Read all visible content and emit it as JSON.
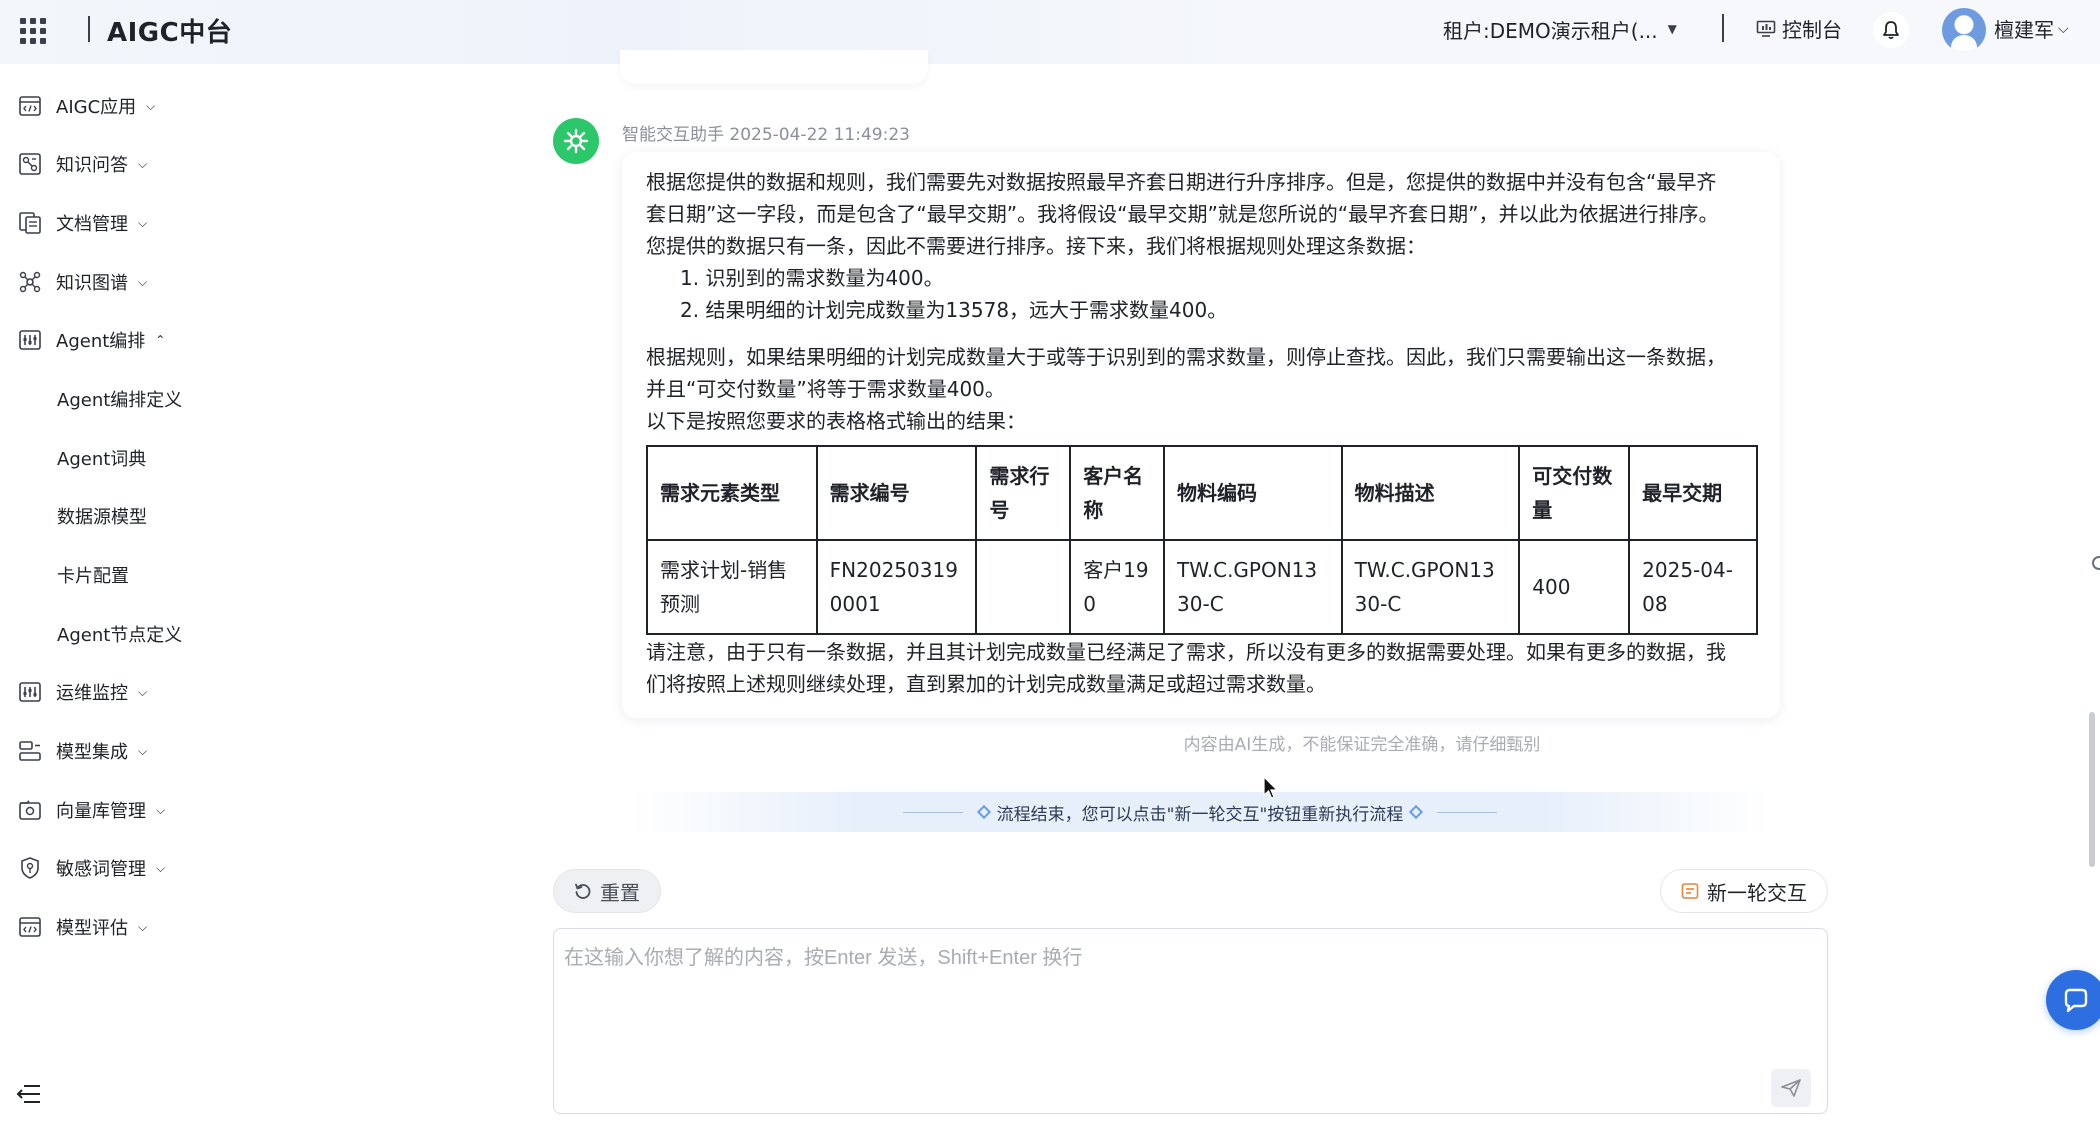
{
  "header": {
    "brand": "AIGC中台",
    "tenant": "租户:DEMO演示租户(...",
    "console": "控制台",
    "username": "檀建军"
  },
  "sidebar": {
    "items": [
      {
        "label": "AIGC应用",
        "icon": "code-window-icon",
        "expanded": false
      },
      {
        "label": "知识问答",
        "icon": "qa-icon",
        "expanded": false
      },
      {
        "label": "文档管理",
        "icon": "document-icon",
        "expanded": false
      },
      {
        "label": "知识图谱",
        "icon": "graph-icon",
        "expanded": false
      },
      {
        "label": "Agent编排",
        "icon": "sliders-icon",
        "expanded": true
      },
      {
        "label": "运维监控",
        "icon": "monitor-icon",
        "expanded": false
      },
      {
        "label": "模型集成",
        "icon": "model-icon",
        "expanded": false
      },
      {
        "label": "向量库管理",
        "icon": "vector-db-icon",
        "expanded": false
      },
      {
        "label": "敏感词管理",
        "icon": "shield-icon",
        "expanded": false
      },
      {
        "label": "模型评估",
        "icon": "evaluate-icon",
        "expanded": false
      }
    ],
    "subitems": [
      {
        "label": "Agent编排定义"
      },
      {
        "label": "Agent词典"
      },
      {
        "label": "数据源模型"
      },
      {
        "label": "卡片配置"
      },
      {
        "label": "Agent节点定义"
      }
    ]
  },
  "chat": {
    "sender": "智能交互助手",
    "timestamp": "2025-04-22 11:49:23",
    "paragraph1": [
      "根据您提供的数据和规则，我们需要先对数据按照最早齐套日期进行升序排序。但是，您提供的数据中并没有包含“最早齐",
      "套日期”这一字段，而是包含了“最早交期”。我将假设“最早交期”就是您所说的“最早齐套日期”，并以此为依据进行排序。",
      "您提供的数据只有一条，因此不需要进行排序。接下来，我们将根据规则处理这条数据："
    ],
    "list": [
      "1. 识别到的需求数量为400。",
      "2. 结果明细的计划完成数量为13578，远大于需求数量400。"
    ],
    "paragraph2": [
      "根据规则，如果结果明细的计划完成数量大于或等于识别到的需求数量，则停止查找。因此，我们只需要输出这一条数据，",
      "并且“可交付数量”将等于需求数量400。",
      "以下是按照您要求的表格格式输出的结果："
    ],
    "table": {
      "headers": [
        "需求元素类型",
        "需求编号",
        "需求行号",
        "客户名称",
        "物料编码",
        "物料描述",
        "可交付数量",
        "最早交期"
      ],
      "rows": [
        [
          "需求计划-销售预测",
          "FN202503190001",
          "",
          "客户190",
          "TW.C.GPON1330-C",
          "TW.C.GPON1330-C",
          "400",
          "2025-04-08"
        ]
      ]
    },
    "paragraph3": [
      "请注意，由于只有一条数据，并且其计划完成数量已经满足了需求，所以没有更多的数据需要处理。如果有更多的数据，我",
      "们将按照上述规则继续处理，直到累加的计划完成数量满足或超过需求数量。"
    ],
    "disclaimer": "内容由AI生成，不能保证完全准确，请仔细甄别",
    "flow_end": "流程结束，您可以点击\"新一轮交互\"按钮重新执行流程"
  },
  "actions": {
    "reset": "重置",
    "new_round": "新一轮交互"
  },
  "input": {
    "placeholder": "在这输入你想了解的内容，按Enter 发送，Shift+Enter 换行",
    "value": ""
  },
  "colors": {
    "accent": "#2d6fe0",
    "bot_avatar": "#2cc76a"
  }
}
